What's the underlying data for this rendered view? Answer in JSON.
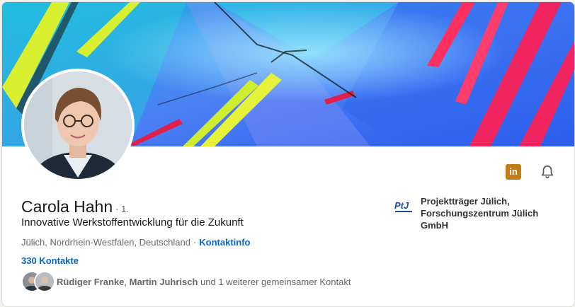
{
  "profile": {
    "name": "Carola Hahn",
    "degree": "· 1.",
    "headline": "Innovative Werkstoffentwicklung für die Zukunft",
    "location": "Jülich, Nordrhein-Westfalen, Deutschland",
    "separator": "·",
    "contact_info_link": "Kontaktinfo",
    "contacts_count": "330 Kontakte"
  },
  "mutual": {
    "name_1": "Rüdiger Franke",
    "comma": ",",
    "name_2": "Martin Juhrisch",
    "rest": "und 1 weiterer gemeinsamer Kontakt"
  },
  "organization": {
    "logo_text": "PtJ",
    "name": "Projektträger Jülich, Forschungszentrum Jülich GmbH"
  },
  "icons": {
    "linkedin": "linkedin-icon",
    "bell": "bell-icon"
  },
  "colors": {
    "link": "#0a66c2",
    "linkedin_badge": "#c37d16"
  }
}
